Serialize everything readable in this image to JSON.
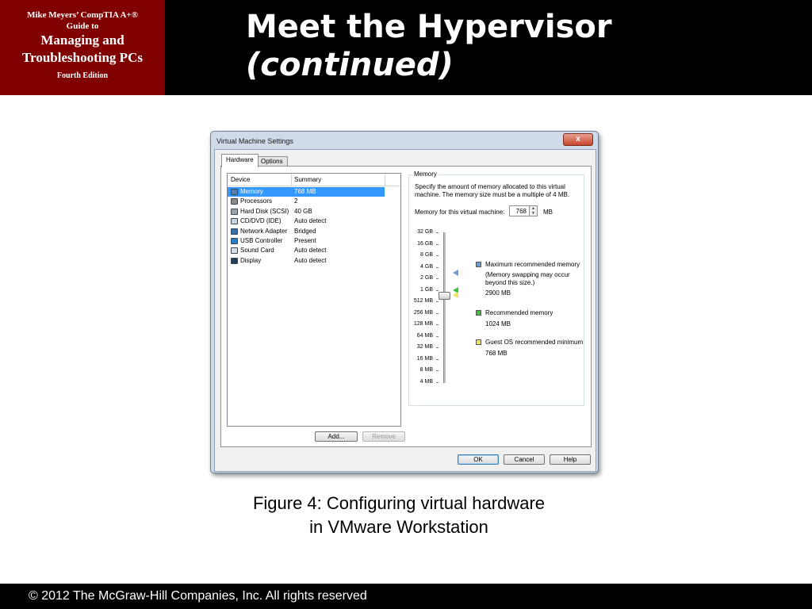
{
  "book": {
    "line1": "Mike Meyers’ CompTIA A+®",
    "line1b": "Guide to",
    "line2": "Managing and",
    "line2b": "Troubleshooting PCs",
    "edition": "Fourth Edition"
  },
  "slide": {
    "title": "Meet the Hypervisor",
    "title_cont": "(continued)",
    "caption_line1": "Figure 4: Configuring virtual hardware",
    "caption_line2": "in VMware Workstation",
    "footer": "© 2012 The McGraw-Hill Companies, Inc. All rights reserved"
  },
  "dialog": {
    "title": "Virtual Machine Settings",
    "close_label": "x",
    "tabs": [
      {
        "label": "Hardware",
        "active": true
      },
      {
        "label": "Options",
        "active": false
      }
    ],
    "list": {
      "col_device": "Device",
      "col_summary": "Summary",
      "rows": [
        {
          "device": "Memory",
          "summary": "768 MB",
          "selected": true,
          "icon": "memory-icon",
          "icon_color": "#5b7fa6"
        },
        {
          "device": "Processors",
          "summary": "2",
          "selected": false,
          "icon": "processor-icon",
          "icon_color": "#8a8a8a"
        },
        {
          "device": "Hard Disk (SCSI)",
          "summary": "40 GB",
          "selected": false,
          "icon": "hard-disk-icon",
          "icon_color": "#9aa4ad"
        },
        {
          "device": "CD/DVD (IDE)",
          "summary": "Auto detect",
          "selected": false,
          "icon": "cd-dvd-icon",
          "icon_color": "#c9d3dc"
        },
        {
          "device": "Network Adapter",
          "summary": "Bridged",
          "selected": false,
          "icon": "network-adapter-icon",
          "icon_color": "#3a6ea5"
        },
        {
          "device": "USB Controller",
          "summary": "Present",
          "selected": false,
          "icon": "usb-icon",
          "icon_color": "#2f7bbf"
        },
        {
          "device": "Sound Card",
          "summary": "Auto detect",
          "selected": false,
          "icon": "sound-card-icon",
          "icon_color": "#d8dde2"
        },
        {
          "device": "Display",
          "summary": "Auto detect",
          "selected": false,
          "icon": "display-icon",
          "icon_color": "#233c5c"
        }
      ]
    },
    "add_label": "Add...",
    "remove_label": "Remove",
    "memory": {
      "legend": "Memory",
      "description": "Specify the amount of memory allocated to this virtual machine. The memory size must be a multiple of 4 MB.",
      "field_label": "Memory for this virtual machine:",
      "value": "768",
      "unit": "MB",
      "scale": [
        "32 GB",
        "16 GB",
        "8 GB",
        "4 GB",
        "2 GB",
        "1 GB",
        "512 MB",
        "256 MB",
        "128 MB",
        "64 MB",
        "32 MB",
        "16 MB",
        "8 MB",
        "4 MB"
      ],
      "current_mb": 768,
      "max_recommended_label": "Maximum recommended memory",
      "max_recommended_note": "(Memory swapping may occur beyond this size.)",
      "max_recommended_value": "2900 MB",
      "max_recommended_mb": 2900,
      "recommended_label": "Recommended memory",
      "recommended_value": "1024 MB",
      "recommended_mb": 1024,
      "guest_min_label": "Guest OS recommended minimum",
      "guest_min_value": "768 MB",
      "guest_min_mb": 768,
      "colors": {
        "max": "#6b9bd1",
        "recommended": "#3fbf3f",
        "guest_min": "#f2e35a"
      }
    },
    "ok_label": "OK",
    "cancel_label": "Cancel",
    "help_label": "Help"
  }
}
